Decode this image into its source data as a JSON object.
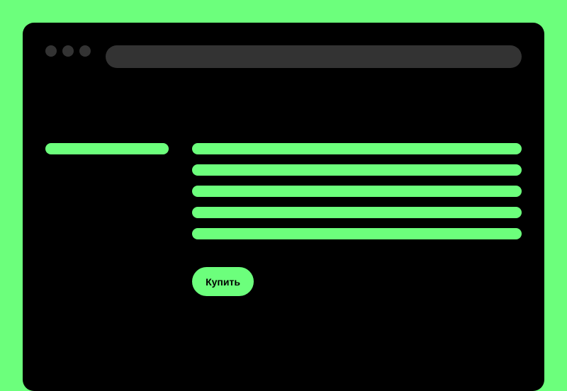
{
  "colors": {
    "background": "#6cff7c",
    "window": "#000000",
    "chrome": "#333333",
    "accent": "#6cff7c"
  },
  "buy_button": {
    "label": "Купить"
  }
}
